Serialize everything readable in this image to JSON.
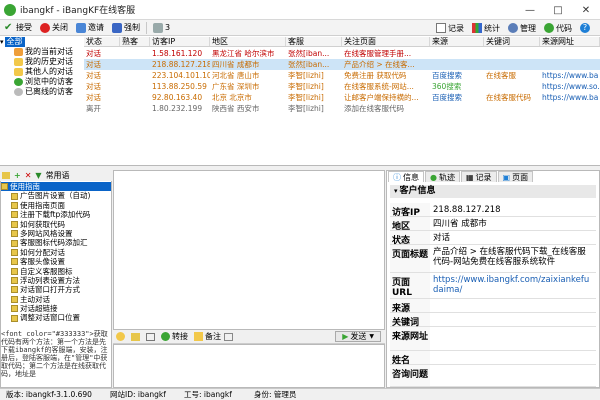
{
  "window": {
    "title": "ibangkf - iBangKF在线客服"
  },
  "toolbar": {
    "accept": "接受",
    "close": "关闭",
    "invite": "邀请",
    "force": "强制",
    "count": "3",
    "record": "记录",
    "stats": "统计",
    "manage": "管理",
    "code": "代码",
    "help": "?"
  },
  "tree": {
    "root": "全部",
    "items": [
      "我的当前对话",
      "我的历史对话",
      "其他人的对话",
      "浏览中的访客",
      "已离线的访客"
    ]
  },
  "table": {
    "headers": [
      "状态",
      "熟客",
      "访客IP",
      "地区",
      "客服",
      "关注页面",
      "来源",
      "关键词",
      "来源网址"
    ],
    "rows": [
      [
        "对话",
        "",
        "1.58.161.120",
        "黑龙江省 哈尔滨市",
        "张然[iban...",
        "在线客服管理手册...",
        "",
        "",
        ""
      ],
      [
        "对话",
        "",
        "218.88.127.218",
        "四川省 成都市",
        "张然[iban...",
        "产品介绍 > 在线客...",
        "",
        "",
        ""
      ],
      [
        "对话",
        "",
        "223.104.101.106",
        "河北省 唐山市",
        "李智[lizhi]",
        "免费注册 获取代码",
        "百度搜索",
        "在线客服",
        "https://www.ba"
      ],
      [
        "对话",
        "",
        "113.88.250.59",
        "广东省 深圳市",
        "李智[lizhi]",
        "在线客服系统-网站...",
        "360搜索",
        "",
        "https://www.so."
      ],
      [
        "对话",
        "",
        "92.80.163.40",
        "北京 北京市",
        "李智[lizhi]",
        "让邮客户端保持横的...",
        "百度搜索",
        "在线客服代码",
        "https://www.ba"
      ],
      [
        "离开",
        "",
        "1.80.232.199",
        "陕西省 西安市",
        "李智[lizhi]",
        "添加在线客服代码",
        "",
        "",
        ""
      ]
    ]
  },
  "leftpane": {
    "toolbar_label": "常用语",
    "root": "使用指南",
    "topics": [
      "广告图片设置（自动)",
      "使用指南页面",
      "注册下载ftp添加代码",
      "如何获取代码",
      "多网站风格设置",
      "客服图标代码添加汇",
      "如何分配对话",
      "客服头像设置",
      "自定义客服图标",
      "浮动列表设置方法",
      "对话窗口打开方式",
      "主动对话",
      "对话超链接",
      "调整对话窗口位置"
    ],
    "snippet": "<font color=\"#333333\">获取代码有两个方法：第一个方法是先下载ibangkf的客服端，安装，注册后，登陆客服端，在\"管理\"中获取代码；第二个方法是在线获取代码，地址是"
  },
  "chat": {
    "transfer": "转接",
    "note": "备注",
    "send": "发送"
  },
  "info": {
    "tabs": [
      "信息",
      "轨迹",
      "记录",
      "页面"
    ],
    "header": "客户信息",
    "fields": [
      {
        "label": "访客IP",
        "value": "218.88.127.218"
      },
      {
        "label": "地区",
        "value": "四川省 成都市"
      },
      {
        "label": "状态",
        "value": "对话"
      },
      {
        "label": "页面标题",
        "value": "产品介绍 > 在线客服代码下载_在线客服代码-网站免费在线客服系统软件"
      },
      {
        "label": "页面URL",
        "value": "https://www.ibangkf.com/zaixiankefudaima/"
      },
      {
        "label": "来源",
        "value": ""
      },
      {
        "label": "关键词",
        "value": ""
      },
      {
        "label": "来源网址",
        "value": ""
      },
      {
        "label": "姓名",
        "value": ""
      },
      {
        "label": "咨询问题",
        "value": ""
      }
    ]
  },
  "status": {
    "version": "版本: ibangkf-3.1.0.690",
    "site_id": "网站ID: ibangkf",
    "work_no": "工号: ibangkf",
    "role": "身份: 管理员"
  },
  "colors": {
    "accent_green": "#3aa534",
    "link_blue": "#1a5fb4",
    "orange": "#c86b00",
    "red": "#c00000",
    "purple": "#7a2aa0"
  }
}
